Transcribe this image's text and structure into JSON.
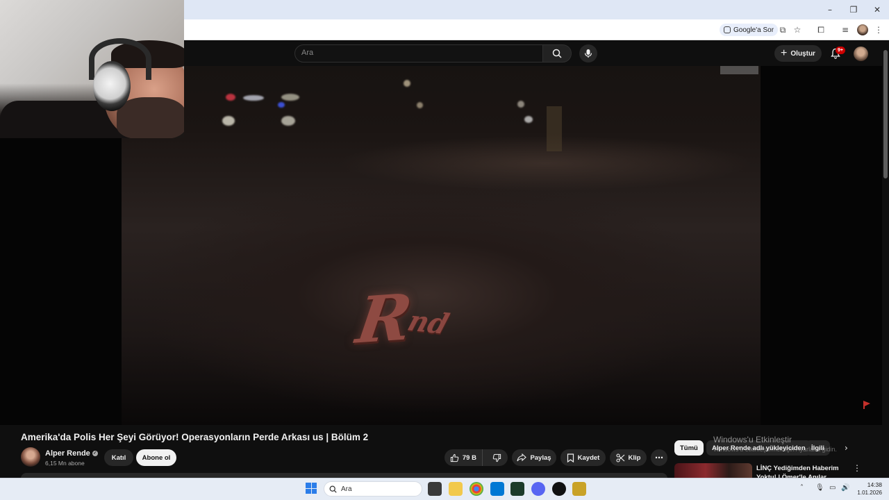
{
  "browser": {
    "ai_chip_label": "Google'a Sor",
    "icons": [
      "google-lens-icon",
      "install-icon",
      "bookmark-star-icon",
      "extensions-icon",
      "media-controls-icon",
      "profile-avatar",
      "kebab-menu-icon"
    ]
  },
  "youtube": {
    "search_placeholder": "Ara",
    "create_label": "Oluştur",
    "notifications_badge": "9+"
  },
  "video": {
    "title": "Amerika'da Polis Her Şeyi Görüyor! Operasyonların Perde Arkası us | Bölüm 2",
    "logo_text_main": "R",
    "logo_text_tail": "nd",
    "channel": {
      "name": "Alper Rende",
      "subscribers": "6,15 Mn abone",
      "join_label": "Katıl",
      "subscribe_label": "Abone ol"
    },
    "actions": {
      "likes": "79 B",
      "share_label": "Paylaş",
      "save_label": "Kaydet",
      "clip_label": "Klip"
    }
  },
  "sidebar": {
    "chips": [
      "Tümü",
      "Alper Rende adlı yükleyiciden",
      "İlgili"
    ],
    "recommendation": {
      "title": "LİNÇ Yediğimden Haberim Yoktu! | Ömer'le Anılar @gokalaf"
    }
  },
  "windows_activation": {
    "line1": "Windows'u Etkinleştir",
    "line2": "Windows'u etkinleştirmek için Ayarlar'a gidin."
  },
  "taskbar": {
    "search_placeholder": "Ara",
    "time": "14:38",
    "date": "1.01.2026",
    "accent_color": "#2b7de9"
  }
}
